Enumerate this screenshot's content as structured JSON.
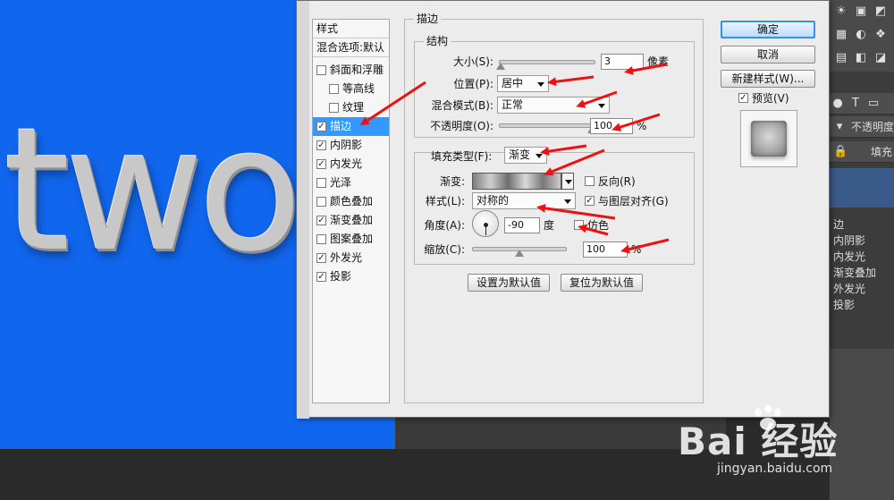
{
  "canvas": {
    "text": "two"
  },
  "dialog": {
    "style_list": {
      "header_styles": "样式",
      "header_blend": "混合选项:默认",
      "items": [
        {
          "label": "斜面和浮雕",
          "checked": false
        },
        {
          "label": "等高线",
          "checked": false
        },
        {
          "label": "纹理",
          "checked": false
        },
        {
          "label": "描边",
          "checked": true
        },
        {
          "label": "内阴影",
          "checked": true
        },
        {
          "label": "内发光",
          "checked": true
        },
        {
          "label": "光泽",
          "checked": false
        },
        {
          "label": "颜色叠加",
          "checked": false
        },
        {
          "label": "渐变叠加",
          "checked": true
        },
        {
          "label": "图案叠加",
          "checked": false
        },
        {
          "label": "外发光",
          "checked": true
        },
        {
          "label": "投影",
          "checked": true
        }
      ],
      "check_mark": "✓"
    },
    "stroke": {
      "title": "描边",
      "structure_title": "结构",
      "size_label": "大小(S):",
      "size_value": "3",
      "size_unit": "像素",
      "position_label": "位置(P):",
      "position_value": "居中",
      "blend_label": "混合模式(B):",
      "blend_value": "正常",
      "opacity_label": "不透明度(O):",
      "opacity_value": "100",
      "opacity_unit": "%",
      "fill_type_label": "填充类型(F):",
      "fill_type_value": "渐变",
      "gradient_label": "渐变:",
      "reverse_label": "反向(R)",
      "style_label": "样式(L):",
      "style_value": "对称的",
      "align_label": "与图层对齐(G)",
      "align_checked": true,
      "angle_label": "角度(A):",
      "angle_value": "-90",
      "angle_unit": "度",
      "dither_label": "仿色",
      "scale_label": "缩放(C):",
      "scale_value": "100",
      "scale_unit": "%",
      "set_default_button": "设置为默认值",
      "reset_default_button": "复位为默认值",
      "size_fraction": 0.02,
      "opacity_fraction": 1.0,
      "scale_fraction": 0.5
    },
    "buttons": {
      "ok": "确定",
      "cancel": "取消",
      "new_style": "新建样式(W)...",
      "preview_label": "预览(V)",
      "preview_checked": true
    }
  },
  "right_panel": {
    "opacity_label": "不透明度",
    "fill_label": "填充",
    "layer_items": [
      "边",
      "内阴影",
      "内发光",
      "渐变叠加",
      "外发光",
      "投影"
    ]
  },
  "watermark": {
    "logo": "Bai  经验",
    "url": "jingyan.baidu.com"
  },
  "colors": {
    "canvas_blue": "#1166ee",
    "selection_blue": "#3399ff",
    "arrow_red": "#ee1111",
    "ok_border": "#3c8ee8"
  }
}
